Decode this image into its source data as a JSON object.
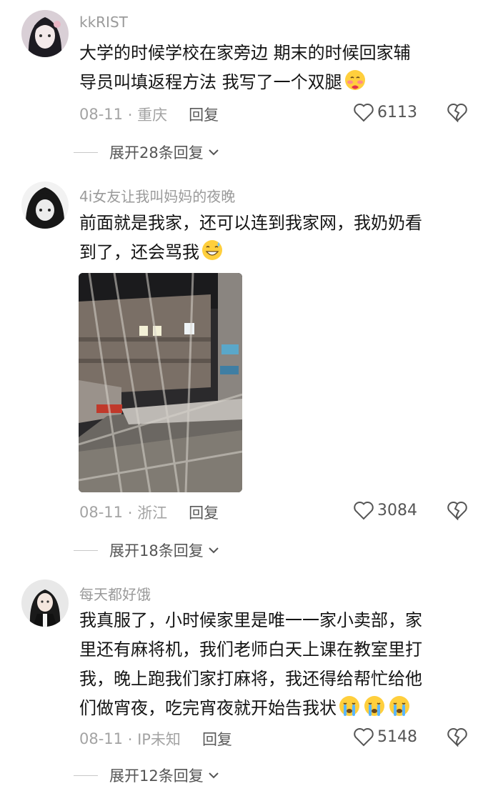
{
  "comments": [
    {
      "username": "kkRIST",
      "text_lines": [
        "大学的时候学校在家旁边 期末的时候回家辅",
        "导员叫填返程方法 我写了一个双腿"
      ],
      "date": "08-11",
      "location": "· 重庆",
      "reply_label": "回复",
      "likes": "6113",
      "expand_label": "展开28条回复",
      "emojis": [
        "blushing-hearts-emoji"
      ]
    },
    {
      "username": "4i女友让我叫妈妈的夜晚",
      "text_lines": [
        "前面就是我家，还可以连到我家网，我奶奶看",
        "到了，还会骂我"
      ],
      "date": "08-11",
      "location": "· 浙江",
      "reply_label": "回复",
      "likes": "3084",
      "expand_label": "展开18条回复",
      "emojis": [
        "grinning-sweat-emoji"
      ]
    },
    {
      "username": "每天都好饿",
      "text_lines": [
        "我真服了，小时候家里是唯一一家小卖部，家",
        "里还有麻将机，我们老师白天上课在教室里打",
        "我，晚上跑我们家打麻将，我还得给帮忙给他",
        "们做宵夜，吃完宵夜就开始告我状"
      ],
      "date": "08-11",
      "location": "· IP未知",
      "reply_label": "回复",
      "likes": "5148",
      "expand_label": "展开12条回复",
      "emojis": [
        "crying-emoji",
        "crying-emoji",
        "crying-emoji"
      ]
    }
  ],
  "colors": {
    "muted": "#9a9a9a",
    "text": "#141414"
  }
}
